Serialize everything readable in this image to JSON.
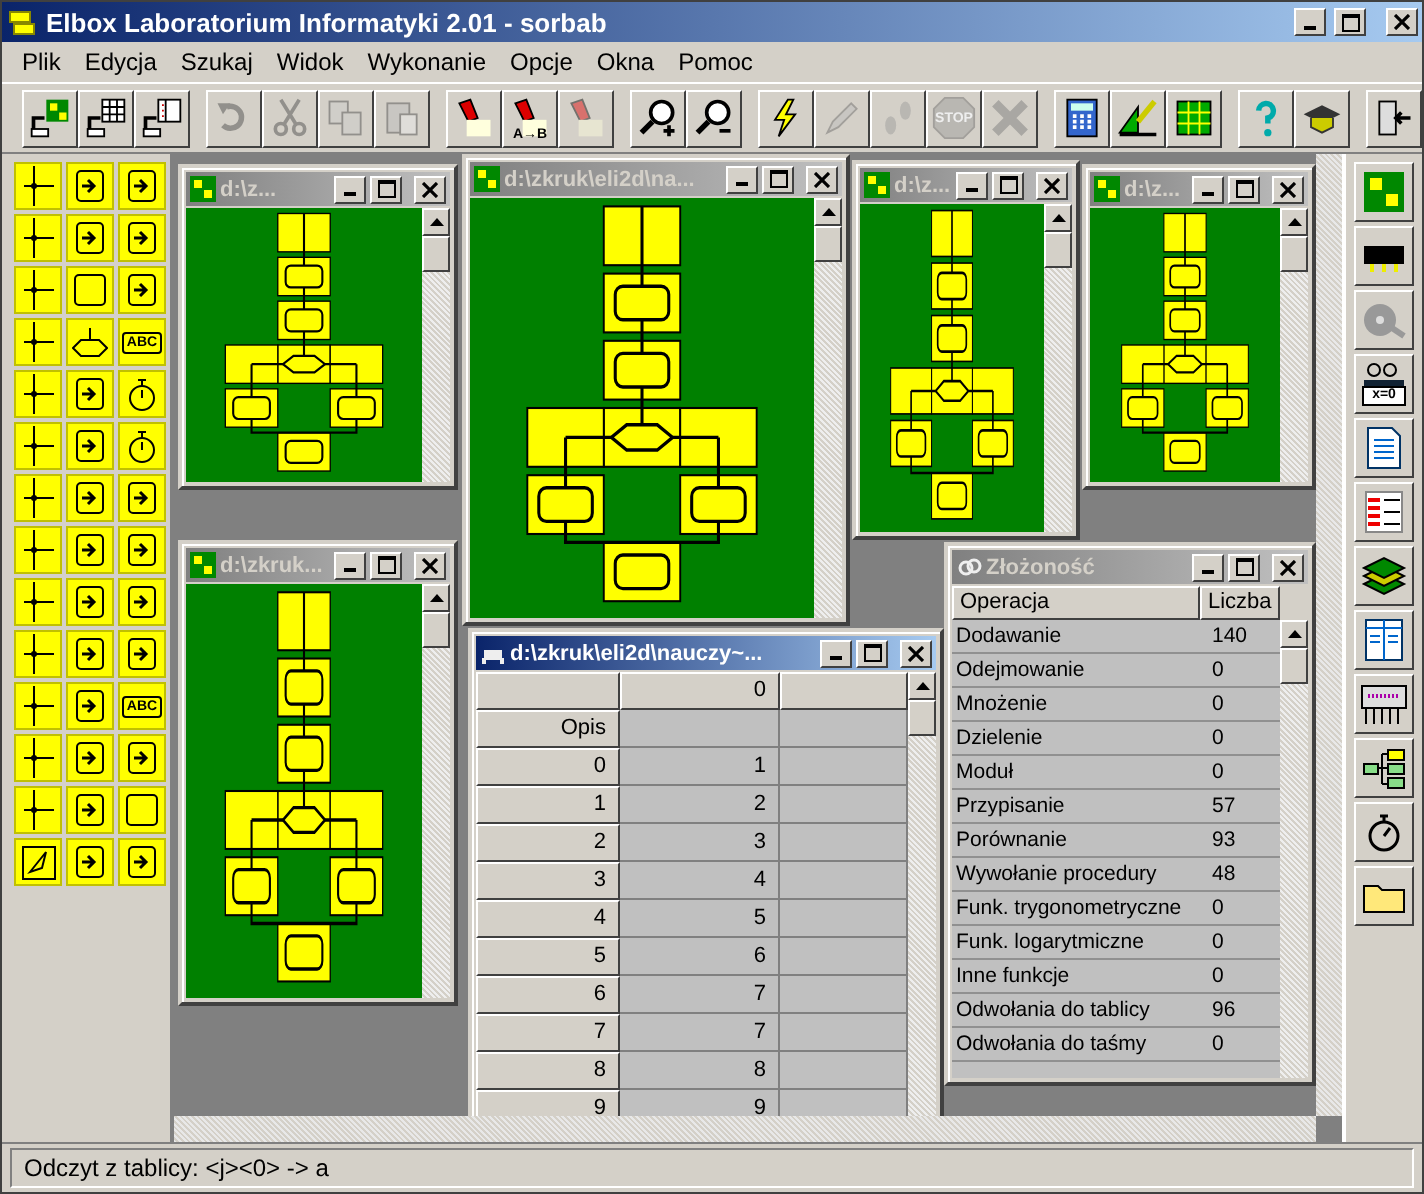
{
  "window": {
    "title": "Elbox Laboratorium Informatyki 2.01 - sorbab"
  },
  "menu": [
    "Plik",
    "Edycja",
    "Szukaj",
    "Widok",
    "Wykonanie",
    "Opcje",
    "Okna",
    "Pomoc"
  ],
  "toolbar": [
    [
      {
        "kind": "new-flow",
        "disabled": false
      },
      {
        "kind": "new-table",
        "disabled": false
      },
      {
        "kind": "new-list",
        "disabled": false
      }
    ],
    [
      {
        "kind": "undo",
        "disabled": true
      },
      {
        "kind": "cut",
        "disabled": true
      },
      {
        "kind": "copy",
        "disabled": true
      },
      {
        "kind": "paste",
        "disabled": true
      }
    ],
    [
      {
        "kind": "torch",
        "disabled": false
      },
      {
        "kind": "torch",
        "disabled": false,
        "label": "A→B"
      },
      {
        "kind": "torch",
        "disabled": true
      }
    ],
    [
      {
        "kind": "zoom-in",
        "disabled": false
      },
      {
        "kind": "zoom-out",
        "disabled": false
      }
    ],
    [
      {
        "kind": "bolt",
        "disabled": false
      },
      {
        "kind": "pencil",
        "disabled": true
      },
      {
        "kind": "steps",
        "disabled": true
      },
      {
        "kind": "stop",
        "disabled": true,
        "label": "STOP"
      },
      {
        "kind": "cross",
        "disabled": true
      }
    ],
    [
      {
        "kind": "calc",
        "disabled": false
      },
      {
        "kind": "ruler",
        "disabled": false
      },
      {
        "kind": "grid",
        "disabled": false
      }
    ],
    [
      {
        "kind": "help",
        "disabled": false
      },
      {
        "kind": "cap",
        "disabled": false
      }
    ],
    [
      {
        "kind": "exit",
        "disabled": false
      }
    ]
  ],
  "palette": [
    {
      "kind": "connector"
    },
    {
      "kind": "io"
    },
    {
      "kind": "io"
    },
    {
      "kind": "connector"
    },
    {
      "kind": "io"
    },
    {
      "kind": "io"
    },
    {
      "kind": "connector"
    },
    {
      "kind": "box"
    },
    {
      "kind": "io"
    },
    {
      "kind": "connector"
    },
    {
      "kind": "decision"
    },
    {
      "kind": "text",
      "label": "ABC"
    },
    {
      "kind": "connector"
    },
    {
      "kind": "io"
    },
    {
      "kind": "clock"
    },
    {
      "kind": "connector"
    },
    {
      "kind": "io"
    },
    {
      "kind": "clock"
    },
    {
      "kind": "connector"
    },
    {
      "kind": "io"
    },
    {
      "kind": "io"
    },
    {
      "kind": "connector"
    },
    {
      "kind": "io"
    },
    {
      "kind": "io"
    },
    {
      "kind": "connector"
    },
    {
      "kind": "io"
    },
    {
      "kind": "io"
    },
    {
      "kind": "connector"
    },
    {
      "kind": "io"
    },
    {
      "kind": "io"
    },
    {
      "kind": "connector"
    },
    {
      "kind": "io"
    },
    {
      "kind": "text",
      "label": "ABC"
    },
    {
      "kind": "connector"
    },
    {
      "kind": "io"
    },
    {
      "kind": "io"
    },
    {
      "kind": "connector"
    },
    {
      "kind": "io"
    },
    {
      "kind": "box"
    },
    {
      "kind": "pointer"
    },
    {
      "kind": "io"
    },
    {
      "kind": "io"
    }
  ],
  "windows": [
    {
      "kind": "flowchart",
      "title": "d:\\z...",
      "active": false
    },
    {
      "kind": "flowchart",
      "title": "d:\\zkruk\\eli2d\\na...",
      "active": false
    },
    {
      "kind": "flowchart",
      "title": "d:\\z...",
      "active": false
    },
    {
      "kind": "flowchart",
      "title": "d:\\z...",
      "active": false
    },
    {
      "kind": "flowchart",
      "title": "d:\\zkruk...",
      "active": false
    },
    {
      "kind": "list",
      "title": "Złożoność",
      "active": false,
      "columns": [
        "Operacja",
        "Liczba"
      ],
      "rows": [
        [
          "Dodawanie",
          "140"
        ],
        [
          "Odejmowanie",
          "0"
        ],
        [
          "Mnożenie",
          "0"
        ],
        [
          "Dzielenie",
          "0"
        ],
        [
          "Moduł",
          "0"
        ],
        [
          "Przypisanie",
          "57"
        ],
        [
          "Porównanie",
          "93"
        ],
        [
          "Wywołanie procedury",
          "48"
        ],
        [
          "Funk. trygonometryczne",
          "0"
        ],
        [
          "Funk. logarytmiczne",
          "0"
        ],
        [
          "Inne funkcje",
          "0"
        ],
        [
          "Odwołania do tablicy",
          "96"
        ],
        [
          "Odwołania do taśmy",
          "0"
        ]
      ]
    },
    {
      "kind": "table",
      "title": "d:\\zkruk\\eli2d\\nauczy~...",
      "active": true,
      "columns": [
        "",
        "0"
      ],
      "rows": [
        [
          "Opis",
          ""
        ],
        [
          "0",
          "1"
        ],
        [
          "1",
          "2"
        ],
        [
          "2",
          "3"
        ],
        [
          "3",
          "4"
        ],
        [
          "4",
          "5"
        ],
        [
          "5",
          "6"
        ],
        [
          "6",
          "7"
        ],
        [
          "7",
          "7"
        ],
        [
          "8",
          "8"
        ],
        [
          "9",
          "9"
        ]
      ]
    }
  ],
  "side_toolbar": [
    {
      "kind": "flow"
    },
    {
      "kind": "chip"
    },
    {
      "kind": "film"
    },
    {
      "kind": "vars",
      "label": "x=0"
    },
    {
      "kind": "doc"
    },
    {
      "kind": "labels"
    },
    {
      "kind": "stack"
    },
    {
      "kind": "sheet"
    },
    {
      "kind": "tape"
    },
    {
      "kind": "tree"
    },
    {
      "kind": "stopwatch"
    },
    {
      "kind": "folder"
    }
  ],
  "status_bar": "Odczyt z tablicy: <j><0> -> a"
}
